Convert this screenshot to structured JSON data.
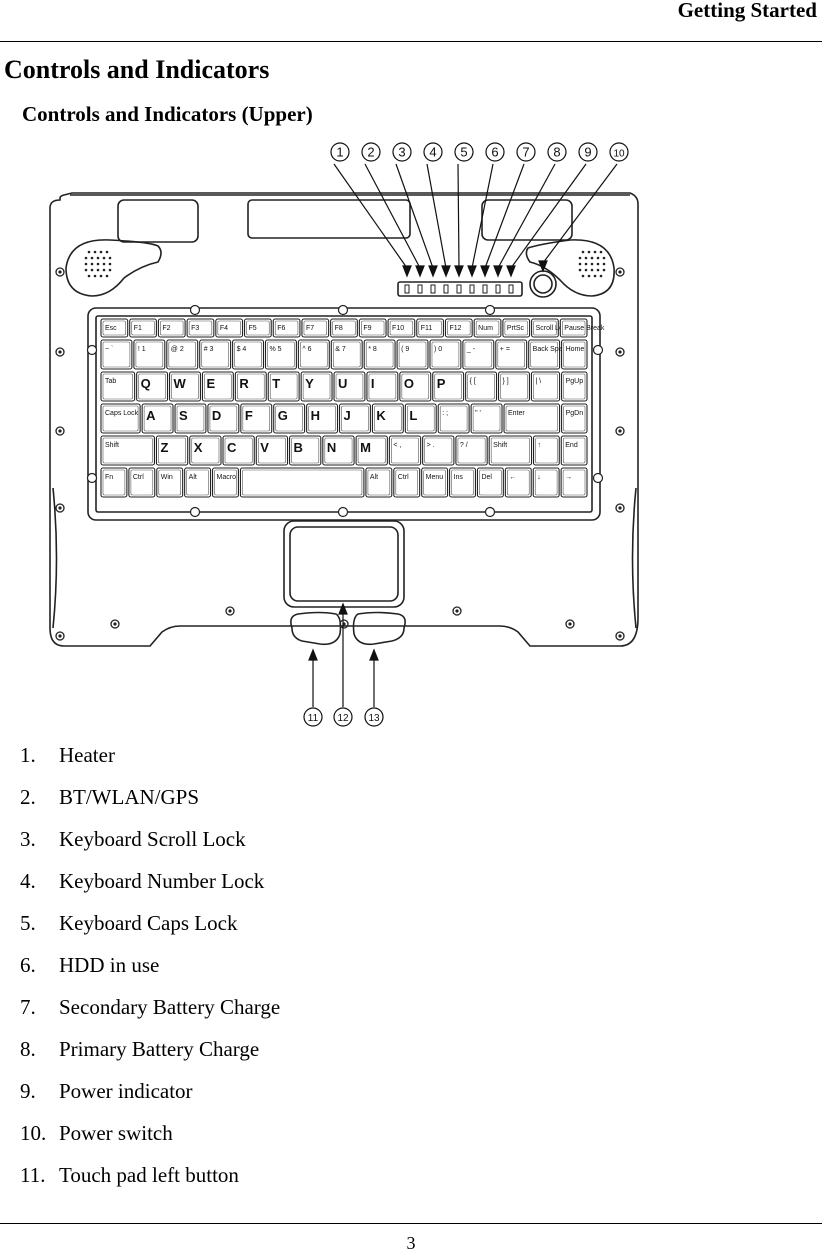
{
  "header": {
    "running_title": "Getting Started"
  },
  "section": {
    "title": "Controls and Indicators",
    "subtitle": "Controls and Indicators (Upper)"
  },
  "figure": {
    "callouts_top": [
      "1",
      "2",
      "3",
      "4",
      "5",
      "6",
      "7",
      "8",
      "9",
      "10"
    ],
    "callouts_bottom": [
      "11",
      "12",
      "13"
    ],
    "keyboard_rows": [
      [
        "Esc",
        "F1",
        "F2",
        "F3",
        "F4",
        "F5",
        "F6",
        "F7",
        "F8",
        "F9",
        "F10",
        "F11",
        "F12",
        "Num",
        "PrtSc",
        "Scroll Lock",
        "Pause Break"
      ],
      [
        "~ `",
        "! 1",
        "@ 2",
        "# 3",
        "$ 4",
        "% 5",
        "^ 6",
        "& 7",
        "* 8",
        "( 9",
        ") 0",
        "_ -",
        "+ =",
        "Back Space",
        "Home"
      ],
      [
        "Tab",
        "Q",
        "W",
        "E",
        "R",
        "T",
        "Y",
        "U",
        "I",
        "O",
        "P",
        "{ [",
        "} ]",
        "| \\",
        "PgUp"
      ],
      [
        "Caps Lock",
        "A",
        "S",
        "D",
        "F",
        "G",
        "H",
        "J",
        "K",
        "L",
        ": ;",
        "\" '",
        "Enter",
        "PgDn"
      ],
      [
        "Shift",
        "Z",
        "X",
        "C",
        "V",
        "B",
        "N",
        "M",
        "< ,",
        "> .",
        "? /",
        "Shift",
        "↑",
        "End"
      ],
      [
        "Fn",
        "Ctrl",
        "Win",
        "Alt",
        "Macro",
        "",
        "Alt",
        "Ctrl",
        "Menu",
        "Ins",
        "Del",
        "←",
        "↓",
        "→"
      ]
    ]
  },
  "list_items": [
    {
      "num": "1.",
      "label": "Heater"
    },
    {
      "num": "2.",
      "label": "BT/WLAN/GPS"
    },
    {
      "num": "3.",
      "label": "Keyboard Scroll Lock"
    },
    {
      "num": "4.",
      "label": "Keyboard Number Lock"
    },
    {
      "num": "5.",
      "label": "Keyboard Caps Lock"
    },
    {
      "num": "6.",
      "label": "HDD in use"
    },
    {
      "num": "7.",
      "label": "Secondary Battery Charge"
    },
    {
      "num": "8.",
      "label": "Primary Battery Charge"
    },
    {
      "num": "9.",
      "label": "Power indicator"
    },
    {
      "num": "10.",
      "label": "Power switch"
    },
    {
      "num": "11.",
      "label": "Touch pad left button"
    }
  ],
  "footer": {
    "page_number": "3"
  }
}
